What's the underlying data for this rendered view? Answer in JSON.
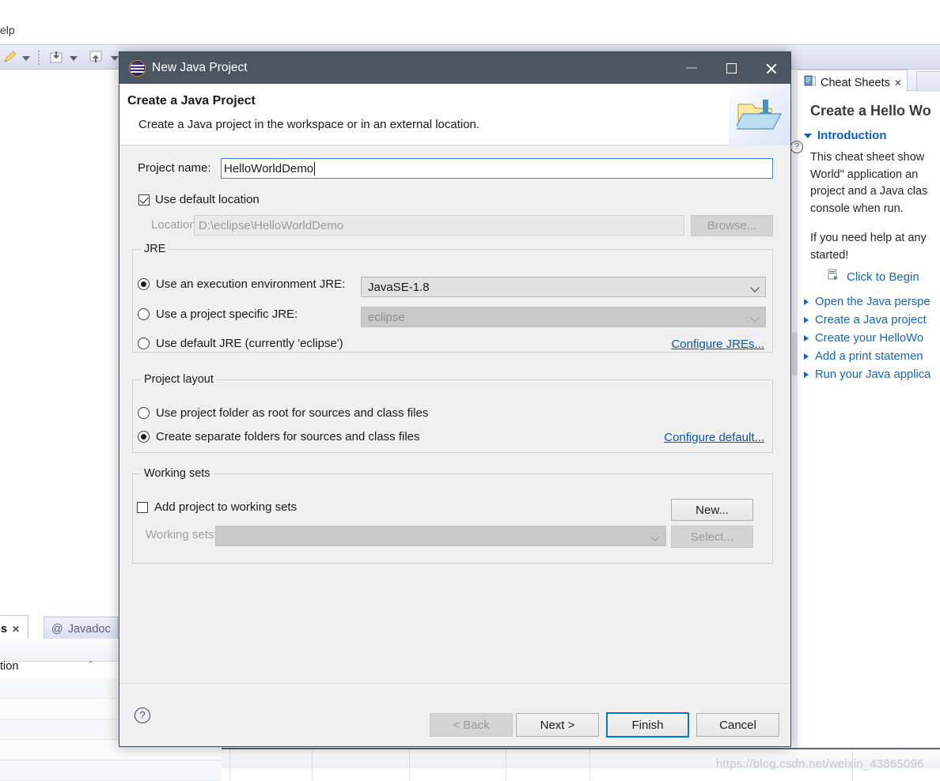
{
  "background": {
    "menu_fragment": "elp",
    "right_panel": {
      "tab_label": "Cheat Sheets",
      "tab_close": "✕",
      "title": "Create a Hello Wo",
      "section": "Introduction",
      "paragraph_lines": [
        "This cheat sheet show",
        "World\" application an",
        "project and a Java clas",
        "console when run."
      ],
      "paragraph2_lines": [
        "If you need help at any",
        "started!"
      ],
      "begin_label": "Click to Begin",
      "links": [
        "Open the Java perspe",
        "Create a Java project",
        "Create your HelloWo",
        "Add a print statemen",
        "Run your Java applica"
      ]
    },
    "bottom_left": {
      "tab_active": "ems",
      "tab_active_close": "✕",
      "tab_inactive_icon": "@",
      "tab_inactive": "Javadoc",
      "column_header": "tion",
      "sort_caret": "⌃"
    },
    "watermark": "https://blog.csdn.net/weixin_43865096"
  },
  "dialog": {
    "title": "New Java Project",
    "window_buttons": {
      "minimize": "minimize",
      "maximize": "maximize",
      "close": "close"
    },
    "header": {
      "heading": "Create a Java Project",
      "description": "Create a Java project in the workspace or in an external location."
    },
    "project_name": {
      "label": "Project name:",
      "value": "HelloWorldDemo"
    },
    "use_default_location": {
      "label": "Use default location",
      "checked": true
    },
    "location": {
      "label": "Location:",
      "value": "D:\\eclipse\\HelloWorldDemo",
      "browse_label": "Browse...",
      "enabled": false
    },
    "jre": {
      "group_label": "JRE",
      "option_execution_env": {
        "label": "Use an execution environment JRE:",
        "selected": true,
        "value": "JavaSE-1.8"
      },
      "option_project_specific": {
        "label": "Use a project specific JRE:",
        "selected": false,
        "value": "eclipse"
      },
      "option_default": {
        "label": "Use default JRE (currently 'eclipse')",
        "selected": false
      },
      "configure_link": "Configure JREs..."
    },
    "project_layout": {
      "group_label": "Project layout",
      "option_root": {
        "label": "Use project folder as root for sources and class files",
        "selected": false
      },
      "option_separate": {
        "label": "Create separate folders for sources and class files",
        "selected": true
      },
      "configure_link": "Configure default..."
    },
    "working_sets": {
      "group_label": "Working sets",
      "add_checkbox": {
        "label": "Add project to working sets",
        "checked": false
      },
      "new_button": "New...",
      "field_label": "Working sets:",
      "field_value": "",
      "select_button": "Select..."
    },
    "footer": {
      "help": "?",
      "back": "< Back",
      "next": "Next >",
      "finish": "Finish",
      "cancel": "Cancel"
    }
  },
  "colors": {
    "titlebar": "#4b5662",
    "dialog_bg": "#f0f0f0",
    "accent_focus": "#0078d7",
    "link": "#0b55a8",
    "cheatsheet_link": "#1565c0"
  }
}
